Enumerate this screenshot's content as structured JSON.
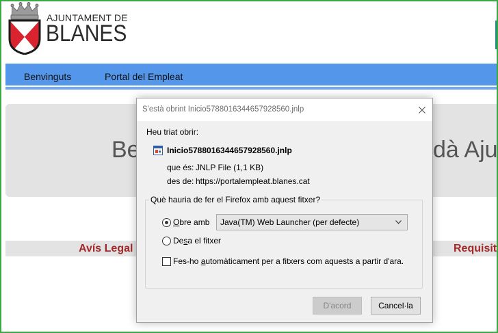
{
  "header": {
    "logo": {
      "icon": "crest-icon",
      "line1": "AJUNTAMENT DE",
      "line2": "BLANES"
    }
  },
  "nav": {
    "items": [
      {
        "label": "Benvinguts"
      },
      {
        "label": "Portal del Empleat"
      }
    ]
  },
  "hero": {
    "text_left": "Be",
    "text_right": "dà Aju"
  },
  "footer_links": {
    "left": "Avís Legal",
    "right": "Requisit"
  },
  "dialog": {
    "title": "S'està obrint Inicio5788016344657928560.jnlp",
    "close_icon": "close-icon",
    "intro": "Heu triat obrir:",
    "file": {
      "icon": "jnlp-file-icon",
      "name": "Inicio5788016344657928560.jnlp",
      "type_label": "que és:",
      "type_value": "JNLP File (1,1 KB)",
      "source_label": "des de:",
      "source_value": "https://portalempleat.blanes.cat"
    },
    "action_group": {
      "legend": "Què hauria de fer el Firefox amb aquest fitxer?",
      "open_with": {
        "label": "Obre amb",
        "selected": true,
        "application": "Java(TM) Web Launcher (per defecte)",
        "dropdown_icon": "chevron-down-icon"
      },
      "save_file": {
        "label": "Desa el fitxer",
        "selected": false
      },
      "remember": {
        "label": "Fes-ho automàticament per a fitxers com aquests a partir d'ara.",
        "checked": false
      }
    },
    "buttons": {
      "ok": {
        "label": "D'acord",
        "disabled": true
      },
      "cancel": {
        "label": "Cancel·la"
      }
    }
  },
  "colors": {
    "frame": "#3aa845",
    "nav": "#5496ea",
    "nav_strip": "#70a7ef",
    "panel": "#e3e3e3",
    "link": "#a3282a",
    "edge_panel": "#1f8f80",
    "crest_red": "#d9232e"
  }
}
